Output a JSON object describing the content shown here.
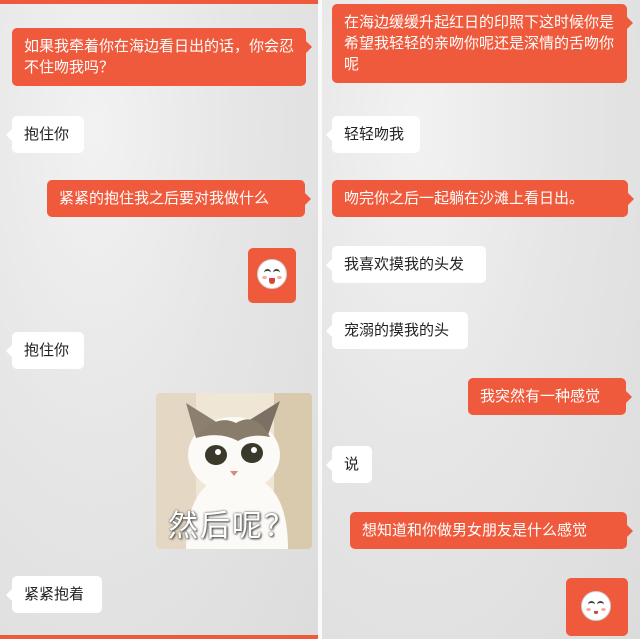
{
  "left_panel": {
    "messages": [
      {
        "side": "sent",
        "text": "如果我牵着你在海边看日出的话，你会忍不住吻我吗？"
      },
      {
        "side": "recv",
        "text": "抱住你"
      },
      {
        "side": "sent",
        "text": "紧紧的抱住我之后要对我做什么"
      },
      {
        "side": "sent",
        "type": "emoji",
        "icon": "smiling-face-emoji-icon"
      },
      {
        "side": "recv",
        "text": "抱住你"
      },
      {
        "side": "sent",
        "type": "sticker",
        "caption": "然后呢？",
        "icon": "cat-sticker-image"
      },
      {
        "side": "recv",
        "text": "紧紧抱着"
      }
    ]
  },
  "right_panel": {
    "messages": [
      {
        "side": "sent",
        "text": "在海边缓缓升起红日的印照下这时候你是希望我轻轻的亲吻你呢还是深情的舌吻你呢"
      },
      {
        "side": "recv",
        "text": "轻轻吻我"
      },
      {
        "side": "sent",
        "text": "吻完你之后一起躺在沙滩上看日出。"
      },
      {
        "side": "recv",
        "text": "我喜欢摸我的头发"
      },
      {
        "side": "recv",
        "text": "宠溺的摸我的头"
      },
      {
        "side": "sent",
        "text": "我突然有一种感觉"
      },
      {
        "side": "recv",
        "text": "说"
      },
      {
        "side": "sent",
        "text": "想知道和你做男女朋友是什么感觉"
      },
      {
        "side": "sent",
        "type": "emoji",
        "icon": "smiling-face-emoji-icon"
      }
    ]
  },
  "colors": {
    "sent_bubble": "#f05a3c",
    "recv_bubble": "#ffffff",
    "background": "#e6e6e6"
  }
}
